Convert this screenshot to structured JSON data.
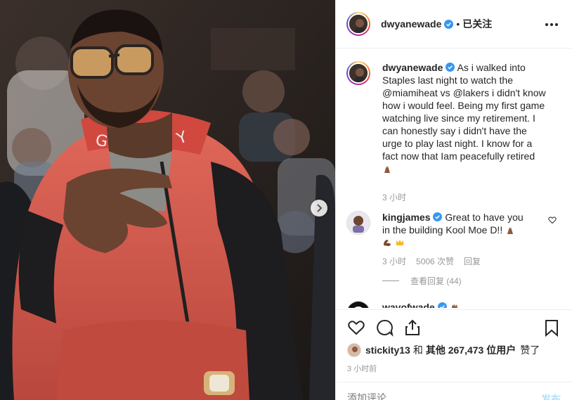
{
  "photo": {
    "alt": "photo",
    "next_label": "›"
  },
  "header": {
    "username": "dwyanewade",
    "dot": "•",
    "follow_label": "已关注"
  },
  "caption": {
    "username": "dwyanewade",
    "text": "As i walked into Staples last night to watch the @miamiheat vs @lakers i didn't know how i would feel. Being my first game watching live since my retirement. I can honestly say i didn't have the urge to play last night. I know for a fact now that Iam peacefully retired",
    "time": "3 小时"
  },
  "comments": [
    {
      "username": "kingjames",
      "text": "Great to have you in the building Kool Moe D!!",
      "time": "3 小时",
      "likes": "5006 次赞",
      "reply_label": "回复",
      "view_replies": "查看回复 (44)"
    },
    {
      "username": "wavofwade"
    }
  ],
  "likes": {
    "first_user": "stickity13",
    "connector": "和",
    "others": "其他 267,473 位用户",
    "suffix": "赞了"
  },
  "timestamp": "3 小时前",
  "add_comment": {
    "placeholder": "添加评论...",
    "post_label": "发布"
  },
  "colors": {
    "verified": "#3897f0",
    "muted": "#999999",
    "text": "#262626",
    "post_disabled": "#b2dffc"
  }
}
